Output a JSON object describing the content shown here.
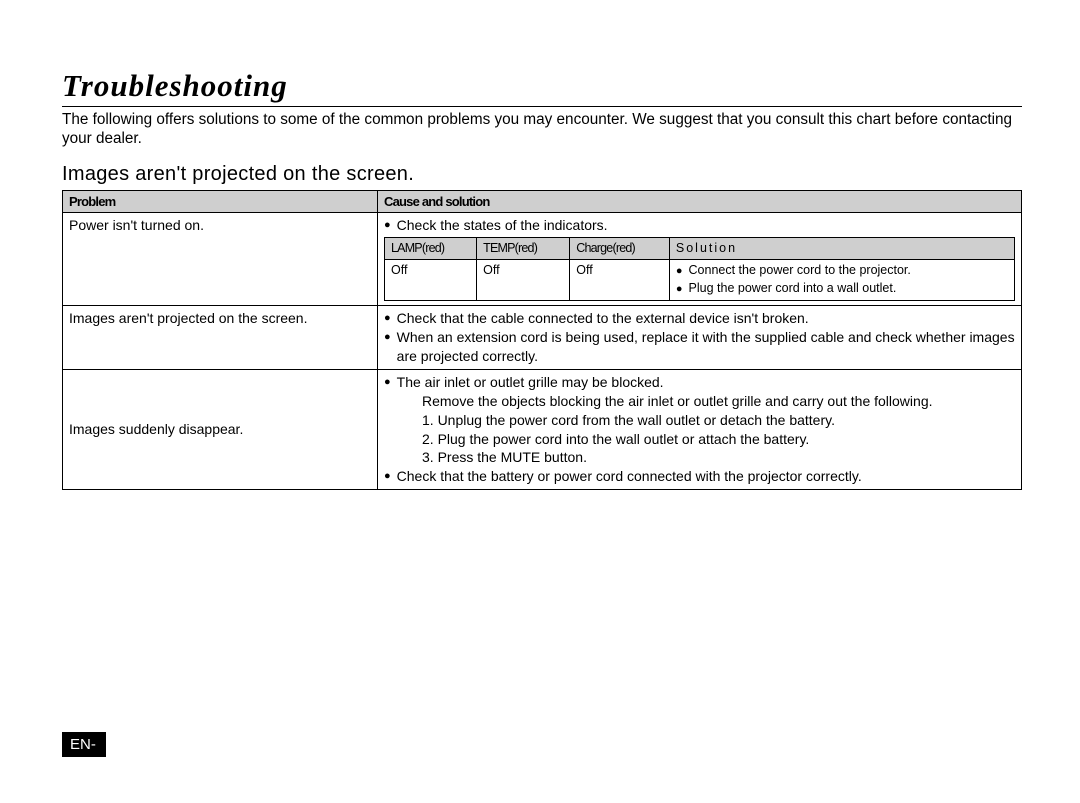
{
  "title": "Troubleshooting",
  "intro": "The following offers solutions to some of the common problems you may encounter. We suggest that you consult this chart before contacting your dealer.",
  "section": "Images aren't projected on the screen.",
  "table": {
    "headers": {
      "problem": "Problem",
      "cause": "Cause and solution"
    },
    "rows": [
      {
        "problem": "Power isn't turned on.",
        "cause_lead": "Check the states of the indicators.",
        "nested": {
          "headers": [
            "LAMP(red)",
            "TEMP(red)",
            "Charge(red)",
            "Solution"
          ],
          "cells": [
            "Off",
            "Off",
            "Off"
          ],
          "solu_1": "Connect the power cord to the projector.",
          "solu_2": "Plug the power cord into a wall outlet."
        }
      },
      {
        "problem": "Images aren't projected on the screen.",
        "line1": "Check that the cable connected to the external device isn't broken.",
        "line2": "When an extension cord is being used, replace it with the supplied cable and check whether images are projected correctly."
      },
      {
        "problem": "Images suddenly disappear.",
        "line1": "The air inlet or outlet grille may be blocked.",
        "sub": "Remove the objects blocking the air inlet or outlet grille and carry out the following.",
        "step1": "1. Unplug the power cord from the wall outlet or detach the battery.",
        "step2": "2. Plug the power cord into the wall outlet or attach the battery.",
        "step3": "3. Press the MUTE button.",
        "line2": "Check that the battery or power cord connected with the projector correctly."
      }
    ]
  },
  "footer": "EN-"
}
